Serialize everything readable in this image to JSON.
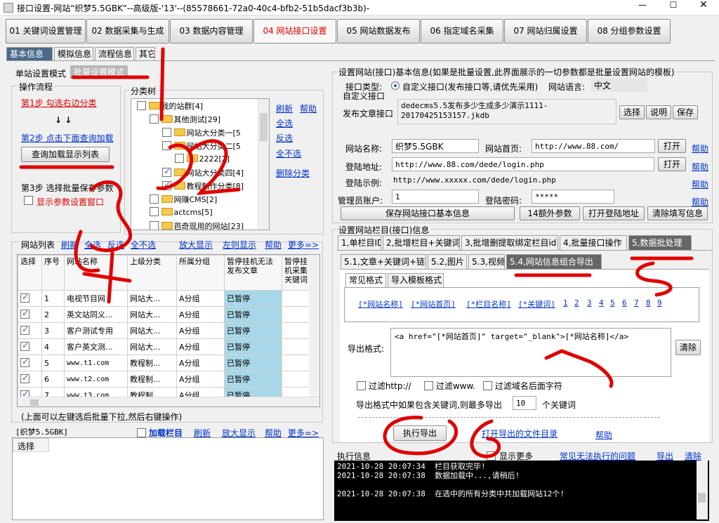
{
  "window": {
    "title": "接口设置-网站“织梦5.5GBK”--高级版-'13'--(85578661-72a0-40c4-bfb2-51b5dacf3b3b)-"
  },
  "main_tabs": [
    "01 关键词设置管理",
    "02 数据采集与生成",
    "03 数据内容管理",
    "04 网站接口设置",
    "05 网站数据发布",
    "06 指定域名采集",
    "07 网站归属设置",
    "08 分组参数设置"
  ],
  "sub_tabs": [
    "基本信息",
    "模拟信息",
    "流程信息",
    "其它"
  ],
  "mode_tabs": {
    "single": "单站设置模式",
    "batch": "批量设置模式"
  },
  "flow": {
    "title": "操作流程",
    "step1": "第1步 勾选右边分类",
    "arrows": "↓    ↓",
    "step2": "第2步 点击下面查询加载",
    "query_btn": "查询加载显示列表",
    "step3": "第3步 选择批量保存参数",
    "show_params": "显示参数设置窗口"
  },
  "category": {
    "title": "分类树",
    "links": [
      "刷新",
      "帮助",
      "全选",
      "反选",
      "全不选",
      "删除分类"
    ],
    "nodes": [
      "我的站群[4]",
      "其他测试[29]",
      "网站大分类一[5",
      "网站大分类二[5",
      "2222[2]",
      "网站大分类四[4]",
      "教程制作分类[8]",
      "网赚CMS[2]",
      "actcms[5]",
      "芭奇现用的网站[23]"
    ]
  },
  "site_list": {
    "title": "网站列表",
    "links": [
      "刷新",
      "全选",
      "反选",
      "全不选",
      "放大显示",
      "左则显示",
      "帮助",
      "更多=>"
    ],
    "headers": [
      "选择",
      "序号",
      "网站名称",
      "上级分类",
      "所属分组",
      "暂停挂机无法发布文章",
      "暂停挂机采集关键词"
    ],
    "rows": [
      [
        "1",
        "电视节目网",
        "网站大...",
        "A分组",
        "已暂停"
      ],
      [
        "2",
        "英文站同义...",
        "网站大...",
        "A分组",
        "已暂停"
      ],
      [
        "3",
        "客户测试专用",
        "网站大...",
        "A分组",
        "已暂停"
      ],
      [
        "4",
        "客户英文测...",
        "网站大...",
        "A分组",
        "已暂停"
      ],
      [
        "5",
        "www.t1.com",
        "教程制...",
        "A分组",
        "已暂停"
      ],
      [
        "6",
        "www.t2.com",
        "教程制...",
        "A分组",
        "已暂停"
      ],
      [
        "7",
        "www.t3.com",
        "教程制...",
        "A分组",
        "已暂停"
      ]
    ],
    "hint": "(上面可以左键选后批量下拉,然后右键操作)"
  },
  "column_panel": {
    "site": "[织梦5.5GBK]",
    "load": "加载栏目",
    "links": [
      "刷新",
      "放大显示",
      "帮助",
      "更多=>"
    ],
    "select_header": "选择"
  },
  "settings": {
    "title": "设置网站(接口)基本信息(如果是批量设置,此界面展示的一切参数都是批量设置网站的模板)",
    "iface_type_label": "接口类型:",
    "iface_type_opt": "自定义接口(发布接口等,请优先采用)",
    "lang_label": "网站语言:",
    "lang": "中文",
    "custom_label": "自定义接口",
    "publish_label": "发布文章接口",
    "publish_value": "dedecms5.5发布多少生成多少演示1111-\n20170425153157.jkdb",
    "btn_select": "选择",
    "btn_explain": "说明",
    "btn_save": "保存",
    "site_name_label": "网站名称:",
    "site_name": "织梦5.5GBK",
    "home_label": "网站首页:",
    "home": "http://www.88.com/",
    "open": "打开",
    "help": "帮助",
    "login_label": "登陆地址:",
    "login": "http://www.88.com/dede/login.php",
    "example_label": "登陆示例:",
    "example": "http://www.xxxxx.com/dede/login.php",
    "admin_label": "管理员账户:",
    "admin": "1",
    "pwd_label": "登陆密码:",
    "pwd": "*****",
    "btn_save_info": "保存网站接口基本信息",
    "btn_extra": "14额外参数",
    "btn_open_login": "打开登陆地址",
    "btn_clear": "清除填写信息"
  },
  "column_settings": {
    "title": "设置网站栏目(接口)信息",
    "tabs": [
      "1,单栏目ID",
      "2,批增栏目+关键词",
      "3,批增删提取绑定栏目id",
      "4,批量接口操作",
      "5,数据批处理"
    ],
    "sub_tabs": [
      "5.1,文章+关键词+链轮",
      "5.2,图片",
      "5.3,视频",
      "5.4,网站信息组合导出"
    ],
    "format_tabs": [
      "常见格式",
      "导入模板格式"
    ],
    "tokens": [
      "[*网站名称]",
      "[*网站首页]",
      "[*栏目名称]",
      "[*关键词]",
      "1",
      "2",
      "3",
      "4",
      "5",
      "6",
      "7",
      "8",
      "9"
    ],
    "export_label": "导出格式:",
    "export_value": "<a href=\"[*网站首页]\" target=\"_blank\">[*网站名称]</a>",
    "clear": "清除",
    "filters": [
      "过滤http://",
      "过滤www.",
      "过滤域名后面字符"
    ],
    "kw_text1": "导出格式中如果包含关键词,则最多导出",
    "kw_max": "10",
    "kw_text2": "个关键词",
    "exec_btn": "执行导出",
    "open_dir": "打开导出的文件目录",
    "help": "帮助"
  },
  "exec_info": {
    "title": "执行信息",
    "show_more": "显示更多",
    "common": "常见无法执行的问题",
    "export": "导出",
    "clear": "清除",
    "log": [
      "2021-10-28 20:07:34  栏目获取完毕!",
      "2021-10-28 20:07:38  数据加载中...,请稍后!",
      "",
      "2021-10-28 20:07:38  在选中的所有分类中共加载网站12个!"
    ]
  },
  "colors": {
    "accent_red": "#e00000",
    "link": "#0033cc",
    "paused_bg": "#a8d8e8",
    "annotation": "#e00000"
  },
  "annotations": [
    "1",
    "2",
    "3",
    "4",
    "5",
    "6"
  ]
}
